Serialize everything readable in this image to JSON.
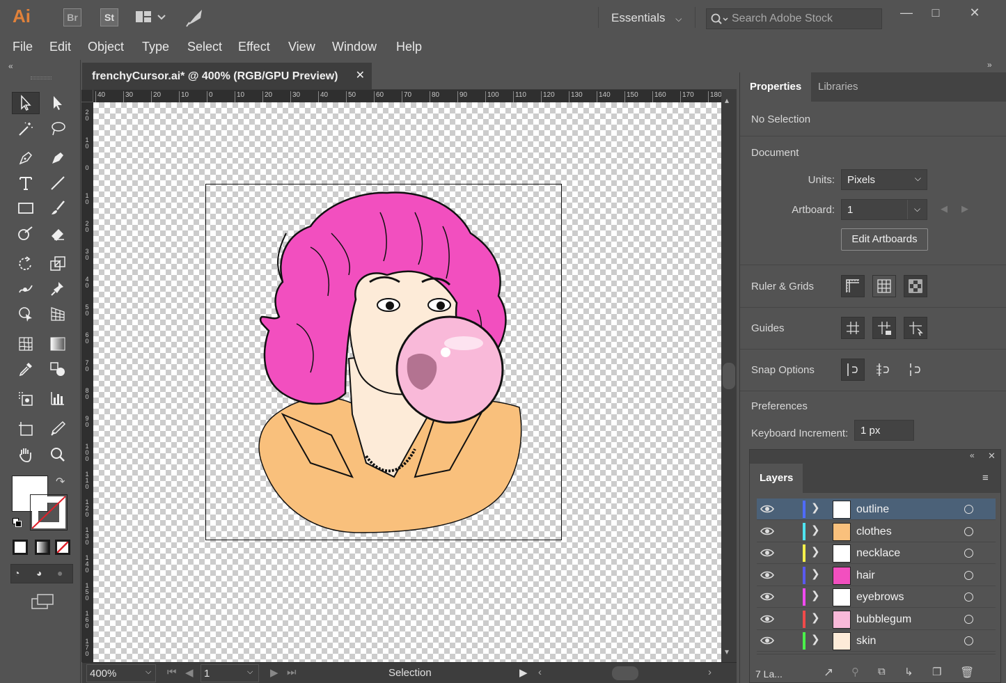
{
  "app": {
    "logo": "Ai",
    "bridge": "Br",
    "stock": "St"
  },
  "titlebar": {
    "workspace": "Essentials",
    "search_placeholder": "Search Adobe Stock"
  },
  "menu": [
    "File",
    "Edit",
    "Object",
    "Type",
    "Select",
    "Effect",
    "View",
    "Window",
    "Help"
  ],
  "document": {
    "tab_title": "frenchyCursor.ai* @ 400% (RGB/GPU Preview)"
  },
  "ruler": {
    "h_ticks": [
      "40",
      "30",
      "20",
      "10",
      "0",
      "10",
      "20",
      "30",
      "40",
      "50",
      "60",
      "70",
      "80",
      "90",
      "100",
      "110",
      "120",
      "130",
      "140",
      "150",
      "160",
      "170",
      "180"
    ],
    "v_ticks": [
      "20",
      "10",
      "0",
      "10",
      "20",
      "30",
      "40",
      "50",
      "60",
      "70",
      "80",
      "90",
      "100",
      "110",
      "120",
      "130",
      "140",
      "150",
      "160",
      "170"
    ]
  },
  "statusbar": {
    "zoom": "400%",
    "artboard": "1",
    "tool_label": "Selection"
  },
  "properties": {
    "tabs": [
      "Properties",
      "Libraries"
    ],
    "selection": "No Selection",
    "document_title": "Document",
    "units_label": "Units:",
    "units_value": "Pixels",
    "artboard_label": "Artboard:",
    "artboard_value": "1",
    "edit_artboards": "Edit Artboards",
    "ruler_grids": "Ruler & Grids",
    "guides": "Guides",
    "snap_options": "Snap Options",
    "preferences": "Preferences",
    "keyboard_increment_label": "Keyboard Increment:",
    "keyboard_increment_value": "1 px"
  },
  "layers": {
    "tab": "Layers",
    "count_label": "7 La...",
    "items": [
      {
        "name": "outline",
        "color": "#4f6bff",
        "selected": true
      },
      {
        "name": "clothes",
        "color": "#4fe5f0",
        "selected": false
      },
      {
        "name": "necklace",
        "color": "#f5f04a",
        "selected": false
      },
      {
        "name": "hair",
        "color": "#5a5af0",
        "selected": false
      },
      {
        "name": "eyebrows",
        "color": "#f04af0",
        "selected": false
      },
      {
        "name": "bubblegum",
        "color": "#f04a4a",
        "selected": false
      },
      {
        "name": "skin",
        "color": "#4af04a",
        "selected": false
      }
    ]
  },
  "colors": {
    "hair": "#f24fbf",
    "skin": "#fdebd8",
    "clothes": "#f9c07c",
    "gum": "#f9b9d9",
    "accent": "#e0813a"
  }
}
